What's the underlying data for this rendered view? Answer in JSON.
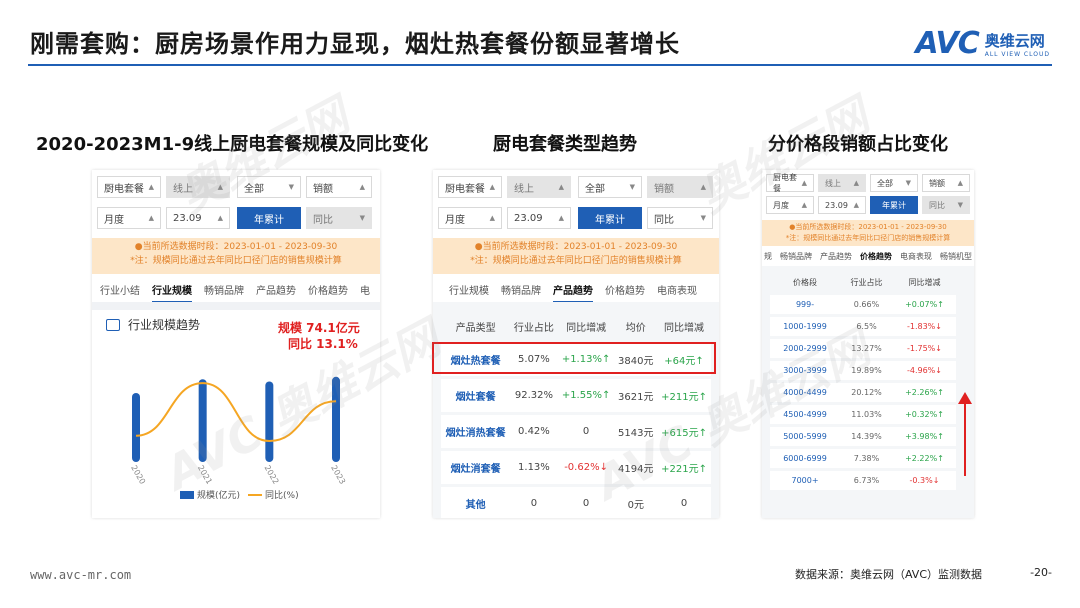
{
  "header": {
    "title": "刚需套购：厨房场景作用力显现，烟灶热套餐份额显著增长",
    "logo_text": "AVC",
    "logo_cn": "奥维云网",
    "logo_en": "ALL VIEW CLOUD"
  },
  "subtitles": [
    "2020-2023M1-9线上厨电套餐规模及同比变化",
    "厨电套餐类型趋势",
    "分价格段销额占比变化"
  ],
  "filters": {
    "row1": [
      "厨电套餐",
      "线上",
      "全部",
      "销额"
    ],
    "row2": [
      "月度",
      "23.09",
      "年累计",
      "同比"
    ]
  },
  "notice": {
    "line1": "●当前所选数据时段：2023-01-01 - 2023-09-30",
    "line2": "*注：规模同比通过去年同比口径门店的销售规模计算"
  },
  "panel1": {
    "tabs": [
      "行业小结",
      "行业规模",
      "畅销品牌",
      "产品趋势",
      "价格趋势",
      "电"
    ],
    "card_title": "行业规模趋势",
    "annotation": [
      "规模 74.1亿元",
      "同比 13.1%"
    ],
    "legend": [
      "规模(亿元)",
      "同比(%)"
    ],
    "x_labels": [
      "2020",
      "2021",
      "2022",
      "2023"
    ]
  },
  "chart_data": {
    "type": "bar",
    "categories": [
      "2020",
      "2021",
      "2022",
      "2023"
    ],
    "series": [
      {
        "name": "规模(亿元)",
        "values": [
          60,
          72,
          70,
          74.1
        ]
      },
      {
        "name": "同比(%)",
        "values": [
          0,
          20,
          -2,
          13.1
        ]
      }
    ]
  },
  "panel2": {
    "tabs": [
      "行业规模",
      "畅销品牌",
      "产品趋势",
      "价格趋势",
      "电商表现"
    ],
    "headers": [
      "产品类型",
      "行业占比",
      "同比增减",
      "均价",
      "同比增减"
    ],
    "rows": [
      {
        "type": "烟灶热套餐",
        "share": "5.07%",
        "share_yoy": "+1.13%↑",
        "price": "3840元",
        "price_yoy": "+64元↑",
        "hl": true
      },
      {
        "type": "烟灶套餐",
        "share": "92.32%",
        "share_yoy": "+1.55%↑",
        "price": "3621元",
        "price_yoy": "+211元↑"
      },
      {
        "type": "烟灶消热套餐",
        "share": "0.42%",
        "share_yoy": "0",
        "price": "5143元",
        "price_yoy": "+615元↑"
      },
      {
        "type": "烟灶消套餐",
        "share": "1.13%",
        "share_yoy": "-0.62%↓",
        "price": "4194元",
        "price_yoy": "+221元↑"
      },
      {
        "type": "其他",
        "share": "0",
        "share_yoy": "0",
        "price": "0元",
        "price_yoy": "0"
      }
    ]
  },
  "panel3": {
    "tabs": [
      "规",
      "畅销品牌",
      "产品趋势",
      "价格趋势",
      "电商表现",
      "畅销机型"
    ],
    "headers": [
      "价格段",
      "行业占比",
      "同比增减"
    ],
    "rows": [
      {
        "seg": "999-",
        "share": "0.66%",
        "yoy": "+0.07%↑",
        "dir": "up"
      },
      {
        "seg": "1000-1999",
        "share": "6.5%",
        "yoy": "-1.83%↓",
        "dir": "dn"
      },
      {
        "seg": "2000-2999",
        "share": "13.27%",
        "yoy": "-1.75%↓",
        "dir": "dn"
      },
      {
        "seg": "3000-3999",
        "share": "19.89%",
        "yoy": "-4.96%↓",
        "dir": "dn"
      },
      {
        "seg": "4000-4499",
        "share": "20.12%",
        "yoy": "+2.26%↑",
        "dir": "up"
      },
      {
        "seg": "4500-4999",
        "share": "11.03%",
        "yoy": "+0.32%↑",
        "dir": "up"
      },
      {
        "seg": "5000-5999",
        "share": "14.39%",
        "yoy": "+3.98%↑",
        "dir": "up"
      },
      {
        "seg": "6000-6999",
        "share": "7.38%",
        "yoy": "+2.22%↑",
        "dir": "up"
      },
      {
        "seg": "7000+",
        "share": "6.73%",
        "yoy": "-0.3%↓",
        "dir": "dn"
      }
    ]
  },
  "footer": {
    "url": "www.avc-mr.com",
    "source": "数据来源：奥维云网（AVC）监测数据",
    "page": "-20-"
  }
}
